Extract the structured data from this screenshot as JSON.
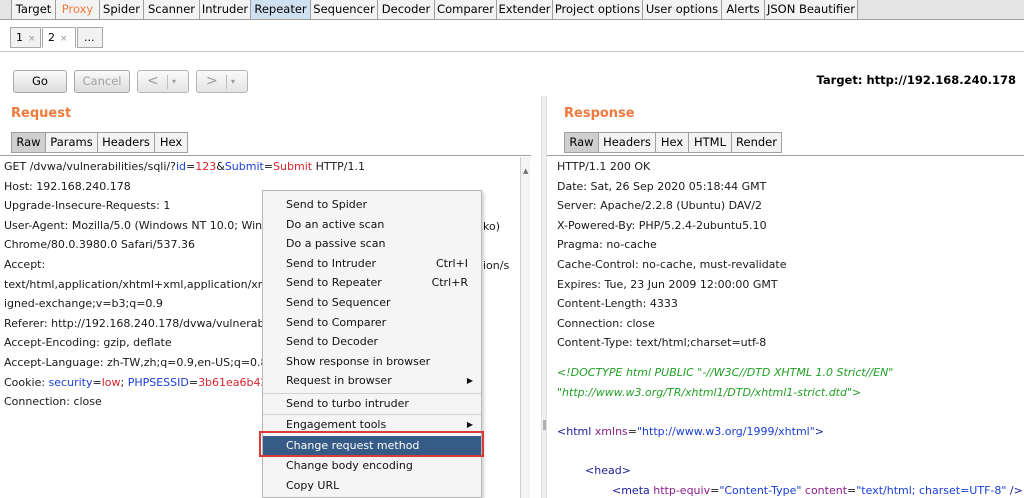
{
  "main_tabs": [
    "Target",
    "Proxy",
    "Spider",
    "Scanner",
    "Intruder",
    "Repeater",
    "Sequencer",
    "Decoder",
    "Comparer",
    "Extender",
    "Project options",
    "User options",
    "Alerts",
    "JSON Beautifier"
  ],
  "sub_tabs": [
    {
      "label": "1",
      "close": "×"
    },
    {
      "label": "2",
      "close": "×"
    },
    {
      "label": "..."
    }
  ],
  "toolbar": {
    "go": "Go",
    "cancel": "Cancel",
    "back": "<",
    "forward": ">",
    "dropdown": "▾",
    "target": "Target: http://192.168.240.178"
  },
  "request": {
    "title": "Request",
    "tabs": [
      "Raw",
      "Params",
      "Headers",
      "Hex"
    ],
    "request_line": {
      "method": "GET /dvwa/vulnerabilities/sqli/?",
      "p1": "id",
      "eq1": "=",
      "v1": "123",
      "amp": "&",
      "p2": "Submit",
      "eq2": "=",
      "v2": "Submit",
      "proto": " HTTP/1.1"
    },
    "lines": [
      "Host: 192.168.240.178",
      "Upgrade-Insecure-Requests: 1",
      "User-Agent: Mozilla/5.0 (Windows NT 10.0; Win64; x",
      "Chrome/80.0.3980.0 Safari/537.36",
      "Accept:",
      "text/html,application/xhtml+xml,application/xml;q=0.",
      "igned-exchange;v=b3;q=0.9",
      "Referer: http://192.168.240.178/dvwa/vulnerabilities/s",
      "Accept-Encoding: gzip, deflate",
      "Accept-Language: zh-TW,zh;q=0.9,en-US;q=0.8,en;"
    ],
    "ua_tail": "ko)",
    "accept_tail": "ion/s",
    "cookie": {
      "label": "Cookie: ",
      "k1": "security",
      "eq1": "=",
      "v1": "low",
      "sep": "; ",
      "k2": "PHPSESSID",
      "eq2": "=",
      "v2": "3b61ea6b42f95e"
    },
    "connection": "Connection: close"
  },
  "response": {
    "title": "Response",
    "tabs": [
      "Raw",
      "Headers",
      "Hex",
      "HTML",
      "Render"
    ],
    "lines": [
      "HTTP/1.1 200 OK",
      "Date: Sat, 26 Sep 2020 05:18:44 GMT",
      "Server: Apache/2.2.8 (Ubuntu) DAV/2",
      "X-Powered-By: PHP/5.2.4-2ubuntu5.10",
      "Pragma: no-cache",
      "Cache-Control: no-cache, must-revalidate",
      "Expires: Tue, 23 Jun 2009 12:00:00 GMT",
      "Content-Length: 4333",
      "Connection: close",
      "Content-Type: text/html;charset=utf-8"
    ],
    "doctype1": "<!DOCTYPE html PUBLIC \"-//W3C//DTD XHTML 1.0 Strict//EN\"",
    "doctype2": "\"http://www.w3.org/TR/xhtml1/DTD/xhtml1-strict.dtd\">",
    "html_tag": {
      "open": "<html ",
      "attr": "xmlns",
      "eq": "=",
      "val": "\"http://www.w3.org/1999/xhtml\"",
      "close": ">"
    },
    "head_tag": "<head>",
    "meta_tag": {
      "open": "<meta ",
      "a1": "http-equiv",
      "eq": "=",
      "v1": "\"Content-Type\"",
      "a2": "content",
      "v2": "\"text/html; charset=UTF-8\"",
      "close": " />"
    }
  },
  "context_menu": [
    {
      "label": "Send to Spider"
    },
    {
      "label": "Do an active scan"
    },
    {
      "label": "Do a passive scan"
    },
    {
      "label": "Send to Intruder",
      "shortcut": "Ctrl+I"
    },
    {
      "label": "Send to Repeater",
      "shortcut": "Ctrl+R"
    },
    {
      "label": "Send to Sequencer"
    },
    {
      "label": "Send to Comparer"
    },
    {
      "label": "Send to Decoder"
    },
    {
      "label": "Show response in browser"
    },
    {
      "label": "Request in browser",
      "submenu": "▶"
    },
    {
      "label": "Send to turbo intruder"
    },
    {
      "label": "Engagement tools",
      "submenu": "▶"
    },
    {
      "label": "Change request method",
      "selected": true
    },
    {
      "label": "Change body encoding"
    },
    {
      "label": "Copy URL"
    }
  ],
  "colors": {
    "accent": "#f07a3c",
    "menu_selected": "#365b87",
    "highlight_box": "#d93a3a"
  }
}
